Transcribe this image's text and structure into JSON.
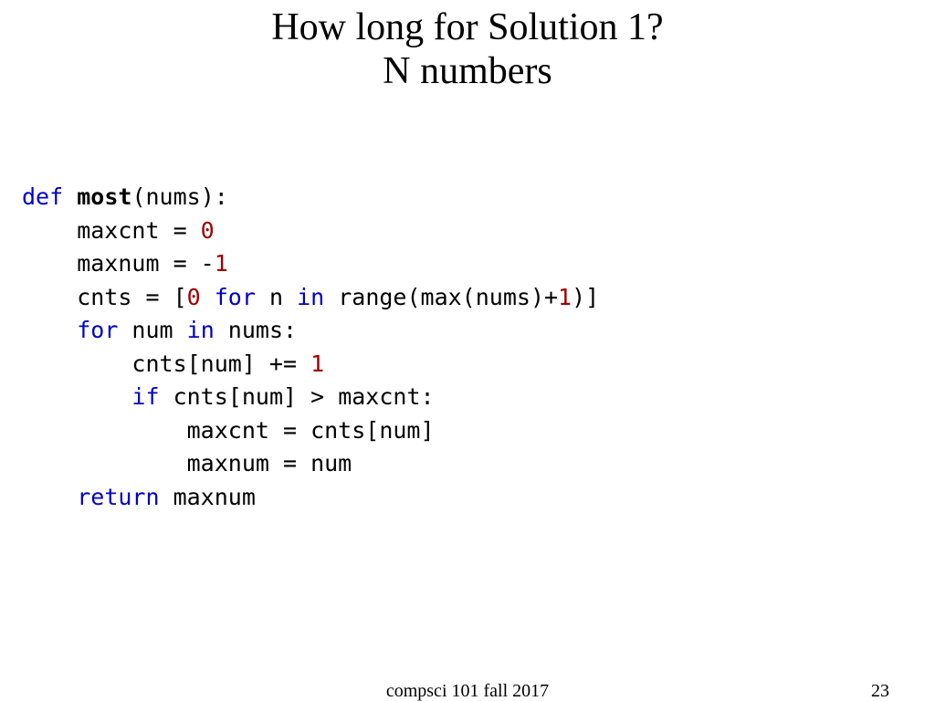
{
  "title": {
    "line1": "How long for Solution 1?",
    "line2": "N numbers"
  },
  "code": {
    "kw_def": "def",
    "fn_name": "most",
    "params_open": "(nums):",
    "l2a": "    maxcnt = ",
    "l2n": "0",
    "l3a": "    maxnum = -",
    "l3n": "1",
    "l4a": "    cnts = [",
    "l4n0": "0",
    "l4b": " ",
    "kw_for": "for",
    "l4c": " n ",
    "kw_in": "in",
    "l4d": " range(max(nums)+",
    "l4n1": "1",
    "l4e": ")]",
    "l5a": "    ",
    "l5b": " num ",
    "l5c": " nums:",
    "l6a": "        cnts[num] += ",
    "l6n": "1",
    "l7a": "        ",
    "kw_if": "if",
    "l7b": " cnts[num] > maxcnt:",
    "l8": "            maxcnt = cnts[num]",
    "l9": "            maxnum = num",
    "l10a": "    ",
    "kw_return": "return",
    "l10b": " maxnum"
  },
  "footer": {
    "center": "compsci 101 fall 2017",
    "page": "23"
  }
}
